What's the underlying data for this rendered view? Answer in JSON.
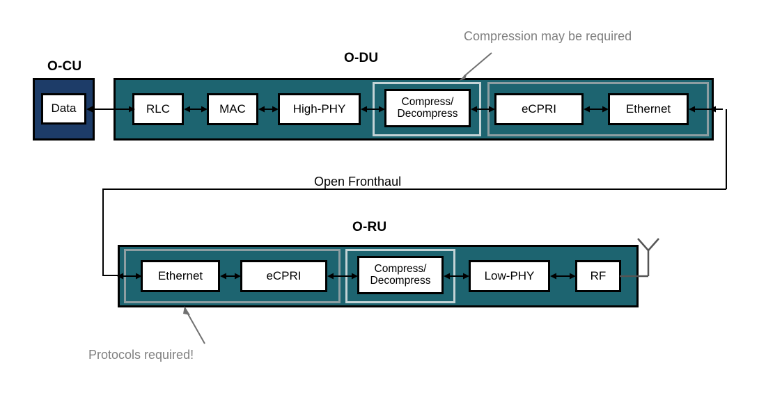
{
  "diagram": {
    "title_ocu": "O-CU",
    "title_odu": "O-DU",
    "title_oru": "O-RU",
    "fronthaul_label": "Open Fronthaul",
    "annotation_compression": "Compression may be required",
    "annotation_protocols": "Protocols required!",
    "colors": {
      "teal": "#1d6470",
      "navy": "#1d3c68",
      "group_light": "#c3d3d6",
      "group_dark": "#8d9ea2",
      "annotation_grey": "#808080",
      "outline_black": "#000000",
      "block_fill": "#ffffff"
    }
  },
  "ocu": {
    "blocks": [
      {
        "label": "Data"
      }
    ]
  },
  "odu": {
    "blocks": [
      {
        "label": "RLC"
      },
      {
        "label": "MAC"
      },
      {
        "label": "High-PHY"
      },
      {
        "label": "Compress/\nDecompress"
      },
      {
        "label": "eCPRI"
      },
      {
        "label": "Ethernet"
      }
    ]
  },
  "oru": {
    "blocks": [
      {
        "label": "Ethernet"
      },
      {
        "label": "eCPRI"
      },
      {
        "label": "Compress/\nDecompress"
      },
      {
        "label": "Low-PHY"
      },
      {
        "label": "RF"
      }
    ]
  },
  "icons": {
    "antenna": "antenna-icon",
    "arrow_bidirectional": "double-arrow-icon",
    "callout_arrow": "callout-arrow-icon"
  }
}
